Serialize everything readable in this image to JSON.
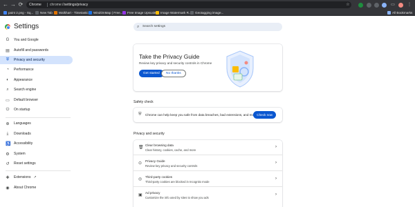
{
  "browser": {
    "nav": {
      "back": "←",
      "forward": "→",
      "reload": "⟳"
    },
    "omnibox": {
      "chip": "Chrome",
      "url_host": "chrome://",
      "url_path": "settings/privacy"
    },
    "right": {
      "star": "☆",
      "menu": "⋮",
      "sidepanel": "▭"
    },
    "bookmarks": [
      {
        "label": "paint 2.png - Sq...",
        "color": "#4285f4"
      },
      {
        "label": "New Tab",
        "color": "#5f6368"
      },
      {
        "label": "Walkhart - Timetastic",
        "color": "#e37400"
      },
      {
        "label": "WindOnMap | Free...",
        "color": "#1a73e8"
      },
      {
        "label": "Free Image Upscale...",
        "color": "#9334e6"
      },
      {
        "label": "Image Watermark R...",
        "color": "#fbbc05"
      },
      {
        "label": "Geotagging image...",
        "color": "#5f6368"
      }
    ],
    "all_bookmarks": "All Bookmarks"
  },
  "settings": {
    "title": "Settings",
    "search": {
      "placeholder": "Search settings"
    },
    "sidebar": {
      "items": [
        {
          "label": "You and Google",
          "icon": "G",
          "icon_name": "google-icon"
        },
        {
          "label": "Autofill and passwords",
          "icon": "▤",
          "icon_name": "autofill-icon"
        },
        {
          "label": "Privacy and security",
          "icon": "⛨",
          "icon_name": "shield-icon",
          "active": true
        },
        {
          "label": "Performance",
          "icon": "◔",
          "icon_name": "speedometer-icon"
        },
        {
          "label": "Appearance",
          "icon": "◐",
          "icon_name": "palette-icon"
        },
        {
          "label": "Search engine",
          "icon": "⌕",
          "icon_name": "search-icon"
        },
        {
          "label": "Default browser",
          "icon": "▭",
          "icon_name": "browser-icon"
        },
        {
          "label": "On startup",
          "icon": "⏻",
          "icon_name": "power-icon"
        },
        {
          "label": "Languages",
          "icon": "⊕",
          "icon_name": "globe-icon"
        },
        {
          "label": "Downloads",
          "icon": "⤓",
          "icon_name": "download-icon"
        },
        {
          "label": "Accessibility",
          "icon": "♿",
          "icon_name": "accessibility-icon"
        },
        {
          "label": "System",
          "icon": "⚙",
          "icon_name": "wrench-icon"
        },
        {
          "label": "Reset settings",
          "icon": "↺",
          "icon_name": "reset-icon"
        },
        {
          "label": "Extensions",
          "icon": "✚",
          "icon_name": "puzzle-icon",
          "external": "↗"
        },
        {
          "label": "About Chrome",
          "icon": "◉",
          "icon_name": "chrome-icon"
        }
      ]
    },
    "privacy_guide": {
      "title": "Take the Privacy Guide",
      "description": "Review key privacy and security controls in Chrome",
      "primary_label": "Get started",
      "secondary_label": "No thanks"
    },
    "safety_check": {
      "heading": "Safety check",
      "text": "Chrome can help keep you safe from data breaches, bad extensions, and more",
      "button": "Check now"
    },
    "privacy_section": {
      "heading": "Privacy and security",
      "rows": [
        {
          "title": "Clear browsing data",
          "subtitle": "Clear history, cookies, cache, and more",
          "icon": "🗑",
          "icon_name": "trash-icon"
        },
        {
          "title": "Privacy Guide",
          "subtitle": "Review key privacy and security controls",
          "icon": "⊙",
          "icon_name": "guide-icon"
        },
        {
          "title": "Third-party cookies",
          "subtitle": "Third-party cookies are blocked in Incognito mode",
          "icon": "◎",
          "icon_name": "cookie-icon"
        },
        {
          "title": "Ad privacy",
          "subtitle": "Customize the info used by sites to show you ads",
          "icon": "▣",
          "icon_name": "ad-icon"
        }
      ],
      "arrow": "›"
    }
  }
}
